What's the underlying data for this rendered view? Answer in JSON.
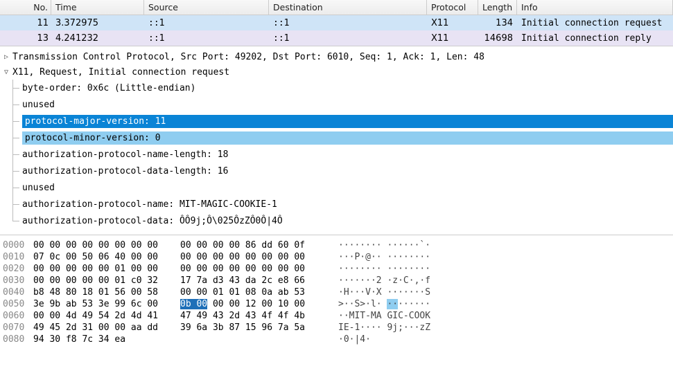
{
  "packet_list": {
    "headers": [
      "No.",
      "Time",
      "Source",
      "Destination",
      "Protocol",
      "Length",
      "Info"
    ],
    "rows": [
      {
        "no": "11",
        "time": "3.372975",
        "src": "::1",
        "dst": "::1",
        "proto": "X11",
        "len": "134",
        "info": "Initial connection request"
      },
      {
        "no": "13",
        "time": "4.241232",
        "src": "::1",
        "dst": "::1",
        "proto": "X11",
        "len": "14698",
        "info": "Initial connection reply"
      }
    ]
  },
  "details": {
    "tcp": "Transmission Control Protocol, Src Port: 49202, Dst Port: 6010, Seq: 1, Ack: 1, Len: 48",
    "x11": "X11, Request, Initial connection request",
    "fields": {
      "byte_order": "byte-order: 0x6c (Little-endian)",
      "unused1": "unused",
      "proto_major": "protocol-major-version: 11",
      "proto_minor": "protocol-minor-version: 0",
      "auth_name_len": "authorization-protocol-name-length: 18",
      "auth_data_len": "authorization-protocol-data-length: 16",
      "unused2": "unused",
      "auth_name": "authorization-protocol-name: MIT-MAGIC-COOKIE-1",
      "auth_data": "authorization-protocol-data: ÔÔ9j;Ô\\025ÔzZÔ0Ô|4Ô"
    }
  },
  "hex": [
    {
      "off": "0000",
      "b1": "00 00 00 00 00 00 00 00",
      "b2": "00 00 00 00 86 dd 60 0f",
      "asc": "········ ······`·"
    },
    {
      "off": "0010",
      "b1": "07 0c 00 50 06 40 00 00",
      "b2": "00 00 00 00 00 00 00 00",
      "asc": "···P·@·· ········"
    },
    {
      "off": "0020",
      "b1": "00 00 00 00 00 01 00 00",
      "b2": "00 00 00 00 00 00 00 00",
      "asc": "········ ········"
    },
    {
      "off": "0030",
      "b1": "00 00 00 00 00 01 c0 32",
      "b2": "17 7a d3 43 da 2c e8 66",
      "asc": "·······2 ·z·C·,·f"
    },
    {
      "off": "0040",
      "b1": "b8 48 80 18 01 56 00 58",
      "b2": "00 00 01 01 08 0a ab 53",
      "asc": "·H···V·X ·······S"
    },
    {
      "off": "0050",
      "b1": "3e 9b ab 53 3e 99 6c 00",
      "b2_pre": "",
      "b2_hi": "0b 00",
      "b2_post": " 00 00 12 00 10 00",
      "asc_pre": ">··S>·l· ",
      "asc_hi": "··",
      "asc_post": "······"
    },
    {
      "off": "0060",
      "b1": "00 00 4d 49 54 2d 4d 41",
      "b2": "47 49 43 2d 43 4f 4f 4b",
      "asc": "··MIT-MA GIC-COOK"
    },
    {
      "off": "0070",
      "b1": "49 45 2d 31 00 00 aa dd",
      "b2": "39 6a 3b 87 15 96 7a 5a",
      "asc": "IE-1···· 9j;···zZ"
    },
    {
      "off": "0080",
      "b1": "94 30 f8 7c 34 ea",
      "b2": "",
      "asc": "·0·|4·"
    }
  ]
}
